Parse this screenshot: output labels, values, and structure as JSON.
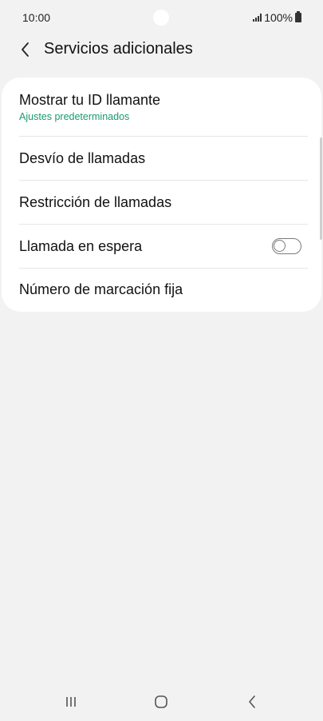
{
  "status_bar": {
    "time": "10:00",
    "battery_text": "100%"
  },
  "header": {
    "title": "Servicios adicionales"
  },
  "settings": {
    "items": [
      {
        "label": "Mostrar tu ID llamante",
        "subtitle": "Ajustes predeterminados"
      },
      {
        "label": "Desvío de llamadas"
      },
      {
        "label": "Restricción de llamadas"
      },
      {
        "label": "Llamada en espera",
        "toggle_on": false
      },
      {
        "label": "Número de marcación fija"
      }
    ]
  },
  "colors": {
    "background": "#f2f2f2",
    "card": "#ffffff",
    "subtitle_accent": "#1a9b6c"
  },
  "icons": {
    "back": "chevron-left-icon",
    "recents": "recents-icon",
    "home": "home-icon",
    "nav_back": "nav-back-icon"
  }
}
